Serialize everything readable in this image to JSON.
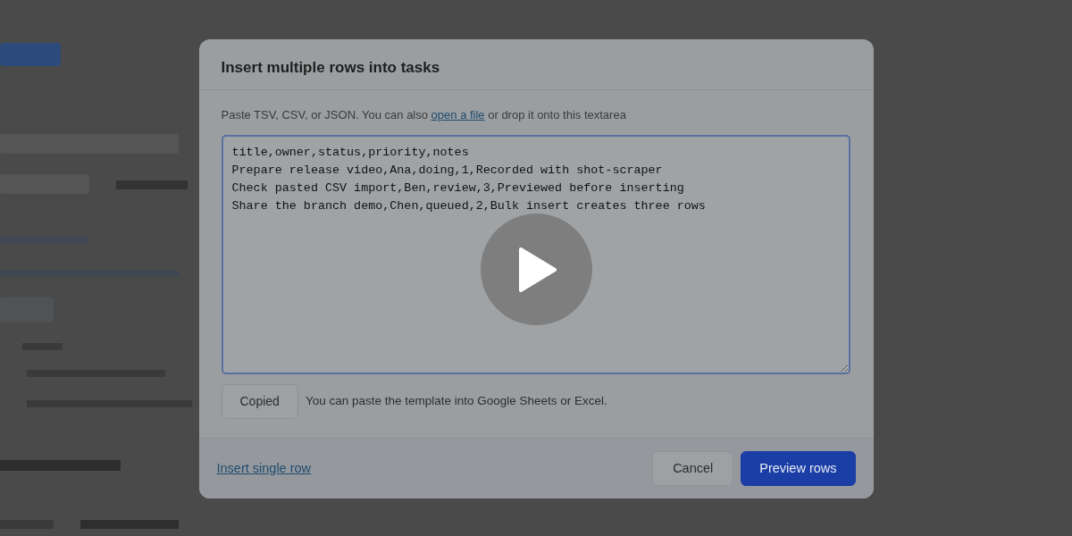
{
  "dialog": {
    "title": "Insert multiple rows into tasks",
    "hint": {
      "before": "Paste TSV, CSV, or JSON. You can also ",
      "link": "open a file",
      "after": " or drop it onto this textarea"
    },
    "textarea_lines": [
      "title,owner,status,priority,notes",
      "Prepare release video,Ana,doing,1,Recorded with shot-scraper",
      "Check pasted CSV import,Ben,review,3,Previewed before inserting",
      "Share the branch demo,Chen,queued,2,Bulk insert creates three rows"
    ],
    "copy_button": "Copied",
    "template_note": "You can paste the template into Google Sheets or Excel.",
    "footer_link": "Insert single row",
    "buttons": [
      {
        "label": "Cancel",
        "kind": "secondary"
      },
      {
        "label": "Preview rows",
        "kind": "primary"
      }
    ]
  },
  "video": {
    "paused": true
  }
}
